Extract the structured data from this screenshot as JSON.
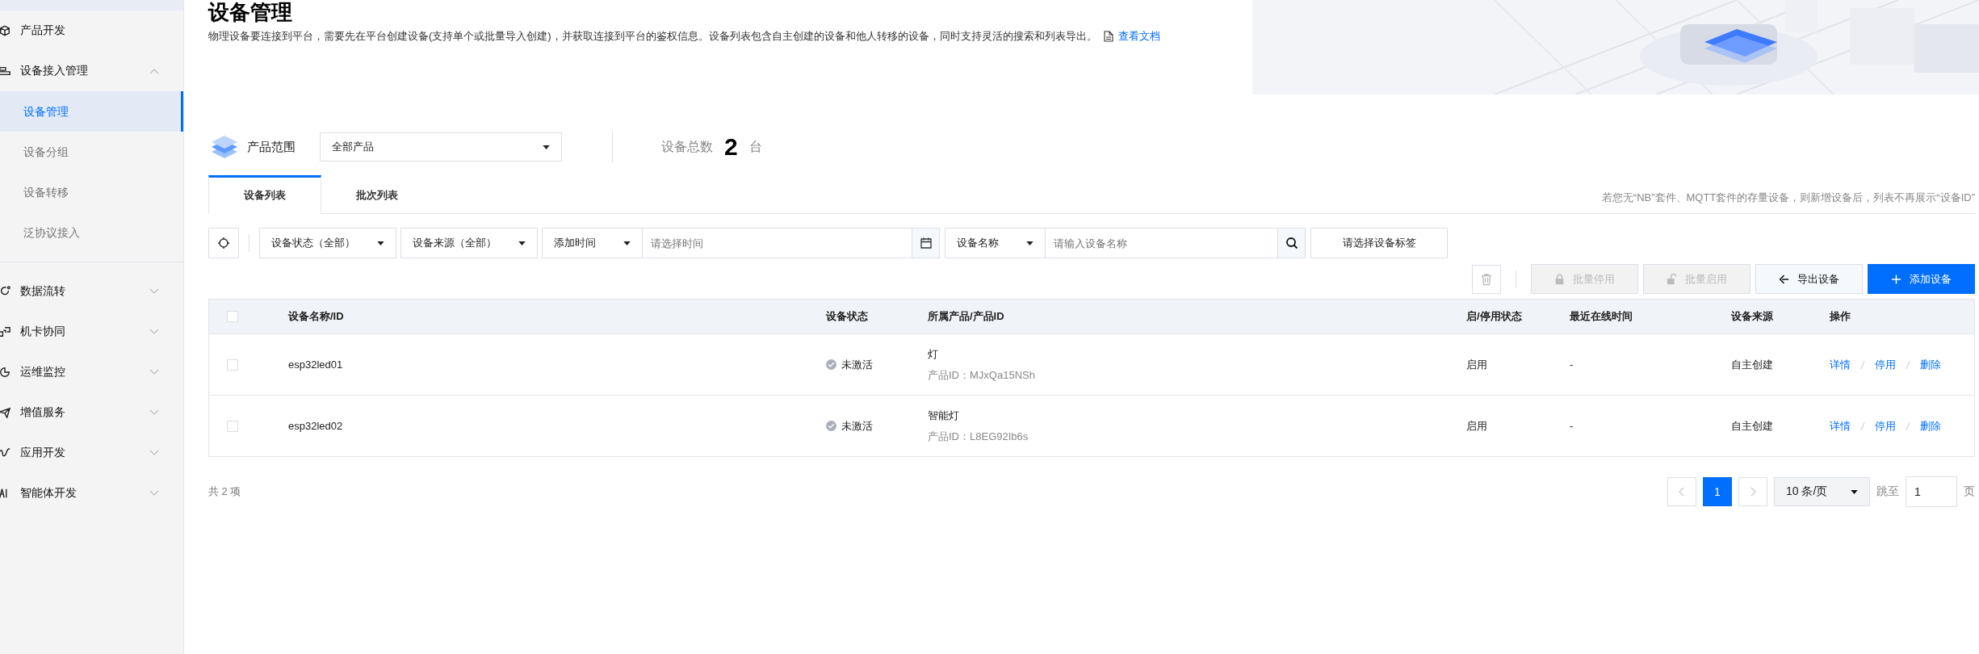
{
  "sidebar": {
    "items": [
      {
        "label": "产品开发"
      },
      {
        "label": "设备接入管理",
        "expanded": true,
        "children": [
          {
            "label": "设备管理",
            "selected": true
          },
          {
            "label": "设备分组",
            "selected": false
          },
          {
            "label": "设备转移",
            "selected": false
          },
          {
            "label": "泛协议接入",
            "selected": false
          }
        ]
      },
      {
        "label": "数据流转",
        "expanded": false
      },
      {
        "label": "机卡协同",
        "expanded": false
      },
      {
        "label": "运维监控",
        "expanded": false
      },
      {
        "label": "增值服务",
        "expanded": false
      },
      {
        "label": "应用开发",
        "expanded": false
      },
      {
        "label": "智能体开发",
        "expanded": false
      }
    ]
  },
  "header": {
    "title": "设备管理",
    "description": "物理设备要连接到平台，需要先在平台创建设备(支持单个或批量导入创建)，并获取连接到平台的鉴权信息。设备列表包含自主创建的设备和他人转移的设备，同时支持灵活的搜索和列表导出。",
    "doc_link": "查看文档"
  },
  "product_scope": {
    "label": "产品范围",
    "value": "全部产品",
    "total_label": "设备总数",
    "total_count": "2",
    "total_unit": "台"
  },
  "tabs": [
    {
      "label": "设备列表",
      "selected": true
    },
    {
      "label": "批次列表",
      "selected": false
    }
  ],
  "tab_note": "若您无“NB”套件、MQTT套件的存量设备，则新增设备后，列表不再展示“设备ID”",
  "filters": {
    "status": "设备状态（全部）",
    "source": "设备来源（全部）",
    "time_field": "添加时间",
    "time_placeholder": "请选择时间",
    "name_field": "设备名称",
    "name_placeholder": "请输入设备名称",
    "tag": "请选择设备标签"
  },
  "actions": [
    {
      "label": "批量停用",
      "disabled": true,
      "primary": false
    },
    {
      "label": "批量启用",
      "disabled": true,
      "primary": false
    },
    {
      "label": "导出设备",
      "disabled": false,
      "primary": false
    },
    {
      "label": "添加设备",
      "disabled": false,
      "primary": true
    }
  ],
  "table": {
    "all_checked": false,
    "columns": [
      "设备名称/ID",
      "设备状态",
      "所属产品/产品ID",
      "启/停用状态",
      "最近在线时间",
      "设备来源",
      "操作"
    ],
    "rows": [
      {
        "checked": false,
        "name": "esp32led01",
        "status": "未激活",
        "product": "灯",
        "product_id": "产品ID：MJxQa15NSh",
        "enable": "启用",
        "last_online": "-",
        "source": "自主创建",
        "ops": [
          "详情",
          "停用",
          "删除"
        ]
      },
      {
        "checked": false,
        "name": "esp32led02",
        "status": "未激活",
        "product": "智能灯",
        "product_id": "产品ID：L8EG92Ib6s",
        "enable": "启用",
        "last_online": "-",
        "source": "自主创建",
        "ops": [
          "详情",
          "停用",
          "删除"
        ]
      }
    ]
  },
  "pagination": {
    "total": "共 2 项",
    "pages": [
      {
        "label": "1",
        "selected": true
      }
    ],
    "page_size": "10 条/页",
    "jump_label": "跳至",
    "jump_value": "1",
    "page_unit": "页"
  }
}
